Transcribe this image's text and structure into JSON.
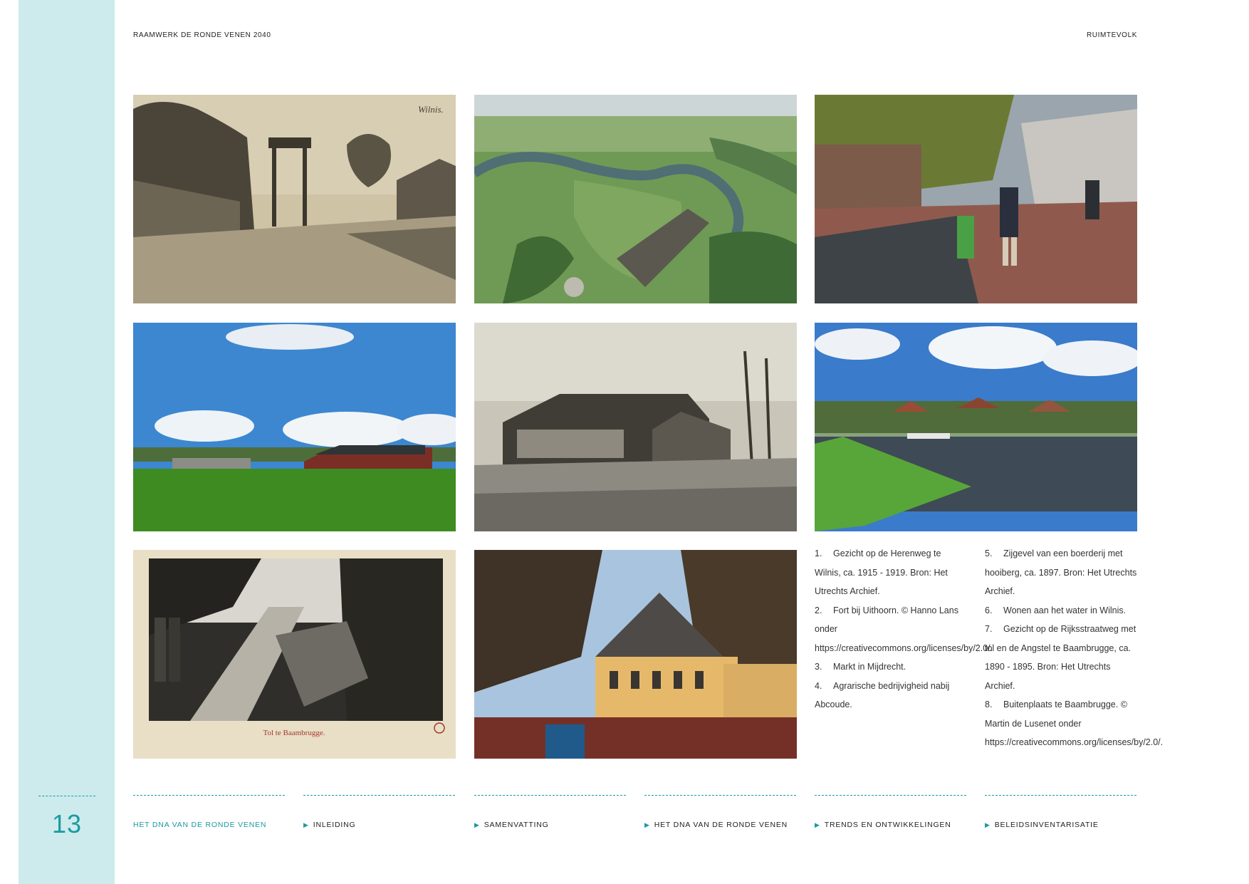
{
  "header": {
    "left": "RAAMWERK DE RONDE VENEN 2040",
    "right": "RUIMTEVOLK"
  },
  "page_number": "13",
  "photos": [
    {
      "name": "photo-herenweg-wilnis",
      "inscription": "Wilnis."
    },
    {
      "name": "photo-fort-uithoorn"
    },
    {
      "name": "photo-markt-mijdrecht"
    },
    {
      "name": "photo-agrarisch-abcoude"
    },
    {
      "name": "photo-boerderij-hooiberg"
    },
    {
      "name": "photo-wonen-water-wilnis"
    },
    {
      "name": "photo-tol-baambrugge",
      "inscription": "Tol te Baambrugge."
    },
    {
      "name": "photo-buitenplaats-baambrugge"
    }
  ],
  "captions": {
    "col1": [
      {
        "num": "1.",
        "text": "Gezicht op de Herenweg te Wilnis, ca. 1915 - 1919. Bron: Het Utrechts Archief."
      },
      {
        "num": "2.",
        "text": "Fort bij Uithoorn. © Hanno Lans onder https://creativecommons.org/licenses/by/2.0/."
      },
      {
        "num": "3.",
        "text": "Markt in Mijdrecht."
      },
      {
        "num": "4.",
        "text": "Agrarische bedrijvigheid nabij Abcoude."
      }
    ],
    "col2": [
      {
        "num": "5.",
        "text": "Zijgevel van een boerderij met hooiberg, ca. 1897. Bron: Het Utrechts Archief."
      },
      {
        "num": "6.",
        "text": "Wonen aan het water in Wilnis."
      },
      {
        "num": "7.",
        "text": "Gezicht op de Rijksstraatweg met tol en de Angstel te Baambrugge, ca. 1890 - 1895. Bron: Het Utrechts Archief."
      },
      {
        "num": "8.",
        "text": "Buitenplaats te Baambrugge. © Martin de Lusenet onder https://creativecommons.org/licenses/by/2.0/."
      }
    ]
  },
  "nav": {
    "current": "HET DNA VAN DE RONDE VENEN",
    "items": [
      "INLEIDING",
      "SAMENVATTING",
      "HET DNA VAN DE RONDE VENEN",
      "TRENDS EN ONTWIKKELINGEN",
      "BELEIDSINVENTARISATIE"
    ]
  },
  "colors": {
    "accent": "#1a9aa3",
    "sidebar": "#cdebec"
  }
}
